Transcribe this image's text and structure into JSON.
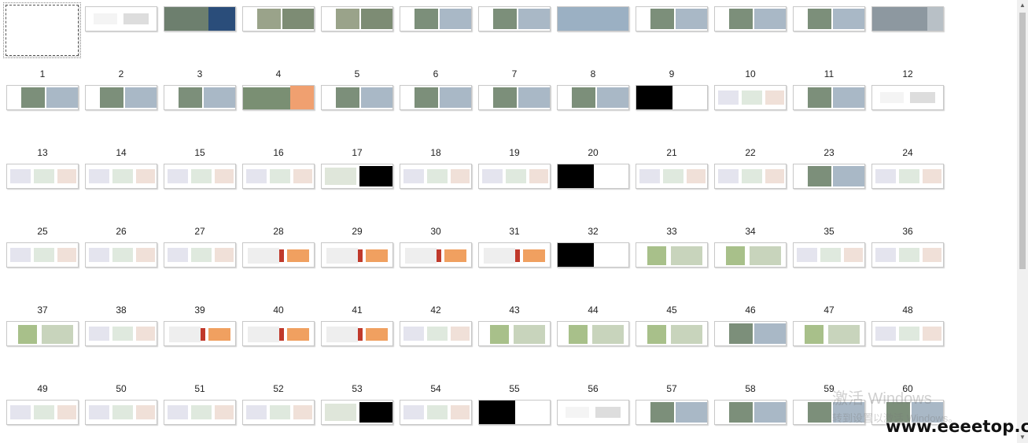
{
  "slides": [
    {
      "number": "1",
      "theme": "blank"
    },
    {
      "number": "2",
      "theme": "text"
    },
    {
      "number": "3",
      "theme": "photo-blue"
    },
    {
      "number": "4",
      "theme": "aerial"
    },
    {
      "number": "5",
      "theme": "aerial"
    },
    {
      "number": "6",
      "theme": "photo"
    },
    {
      "number": "7",
      "theme": "photo"
    },
    {
      "number": "8",
      "theme": "photo-wide"
    },
    {
      "number": "9",
      "theme": "photo"
    },
    {
      "number": "10",
      "theme": "photo"
    },
    {
      "number": "11",
      "theme": "photo"
    },
    {
      "number": "12",
      "theme": "photo-grey"
    },
    {
      "number": "13",
      "theme": "photo"
    },
    {
      "number": "14",
      "theme": "photo"
    },
    {
      "number": "15",
      "theme": "photo"
    },
    {
      "number": "16",
      "theme": "photo-orange"
    },
    {
      "number": "17",
      "theme": "photo"
    },
    {
      "number": "18",
      "theme": "photo"
    },
    {
      "number": "19",
      "theme": "photo"
    },
    {
      "number": "20",
      "theme": "photo"
    },
    {
      "number": "21",
      "theme": "black-map"
    },
    {
      "number": "22",
      "theme": "diagram"
    },
    {
      "number": "23",
      "theme": "photo"
    },
    {
      "number": "24",
      "theme": "text"
    },
    {
      "number": "25",
      "theme": "diagram"
    },
    {
      "number": "26",
      "theme": "diagram"
    },
    {
      "number": "27",
      "theme": "diagram"
    },
    {
      "number": "28",
      "theme": "diagram"
    },
    {
      "number": "29",
      "theme": "black-half"
    },
    {
      "number": "30",
      "theme": "diagram"
    },
    {
      "number": "31",
      "theme": "diagram"
    },
    {
      "number": "32",
      "theme": "black-map"
    },
    {
      "number": "33",
      "theme": "diagram"
    },
    {
      "number": "34",
      "theme": "diagram"
    },
    {
      "number": "35",
      "theme": "photo"
    },
    {
      "number": "36",
      "theme": "diagram"
    },
    {
      "number": "37",
      "theme": "diagram"
    },
    {
      "number": "38",
      "theme": "diagram"
    },
    {
      "number": "39",
      "theme": "diagram"
    },
    {
      "number": "40",
      "theme": "red"
    },
    {
      "number": "41",
      "theme": "red"
    },
    {
      "number": "42",
      "theme": "red"
    },
    {
      "number": "43",
      "theme": "red"
    },
    {
      "number": "44",
      "theme": "black-map"
    },
    {
      "number": "45",
      "theme": "green"
    },
    {
      "number": "46",
      "theme": "green"
    },
    {
      "number": "47",
      "theme": "diagram"
    },
    {
      "number": "48",
      "theme": "diagram"
    },
    {
      "number": "49",
      "theme": "green"
    },
    {
      "number": "50",
      "theme": "diagram"
    },
    {
      "number": "51",
      "theme": "red"
    },
    {
      "number": "52",
      "theme": "red"
    },
    {
      "number": "53",
      "theme": "red"
    },
    {
      "number": "54",
      "theme": "diagram"
    },
    {
      "number": "55",
      "theme": "green"
    },
    {
      "number": "56",
      "theme": "green"
    },
    {
      "number": "57",
      "theme": "green"
    },
    {
      "number": "58",
      "theme": "photo"
    },
    {
      "number": "59",
      "theme": "green"
    },
    {
      "number": "60",
      "theme": "diagram"
    },
    {
      "number": "",
      "theme": "diagram"
    },
    {
      "number": "",
      "theme": "diagram"
    },
    {
      "number": "",
      "theme": "diagram"
    },
    {
      "number": "",
      "theme": "diagram"
    },
    {
      "number": "",
      "theme": "black-half"
    },
    {
      "number": "",
      "theme": "diagram"
    },
    {
      "number": "",
      "theme": "black-map"
    },
    {
      "number": "",
      "theme": "text"
    },
    {
      "number": "",
      "theme": "photo"
    },
    {
      "number": "",
      "theme": "photo"
    },
    {
      "number": "",
      "theme": "photo"
    },
    {
      "number": "",
      "theme": "photo"
    }
  ],
  "selected_slide": "1",
  "scrollbar": {
    "up_arrow": "▲",
    "down_arrow": "▼"
  },
  "watermark": {
    "line1": "激活 Windows",
    "line2": "转到设置以激活 Windows。"
  },
  "site_logo": "www.eeeetop.com",
  "colors": {
    "accent_blue": "#2a4d7a",
    "orange": "#f0a070",
    "red": "#c0392b",
    "green": "#a8c08a",
    "black": "#000000"
  }
}
